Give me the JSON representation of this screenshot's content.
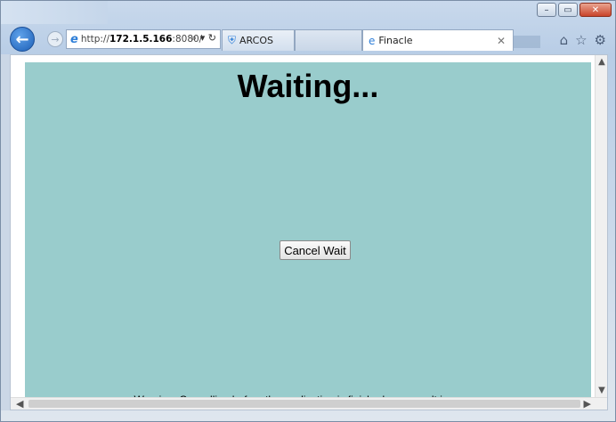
{
  "browser": {
    "address_url_prefix": "http://",
    "address_url_host": "172.1.5.166",
    "address_url_suffix": ":8080/",
    "tabs": [
      {
        "label": "ARCOS"
      },
      {
        "label": ""
      },
      {
        "label": "Finacle",
        "active": true
      }
    ],
    "window_controls": {
      "minimize": "–",
      "maximize": "▭",
      "close": "✕"
    },
    "colors": {
      "accent": "#1d5fb7",
      "close": "#c9442a"
    }
  },
  "page": {
    "heading": "Waiting...",
    "cancel_button_label": "Cancel Wait",
    "warning_text": "Warning: Cancelling before the application is finished may result in errors.",
    "background_color": "#99cccc"
  }
}
